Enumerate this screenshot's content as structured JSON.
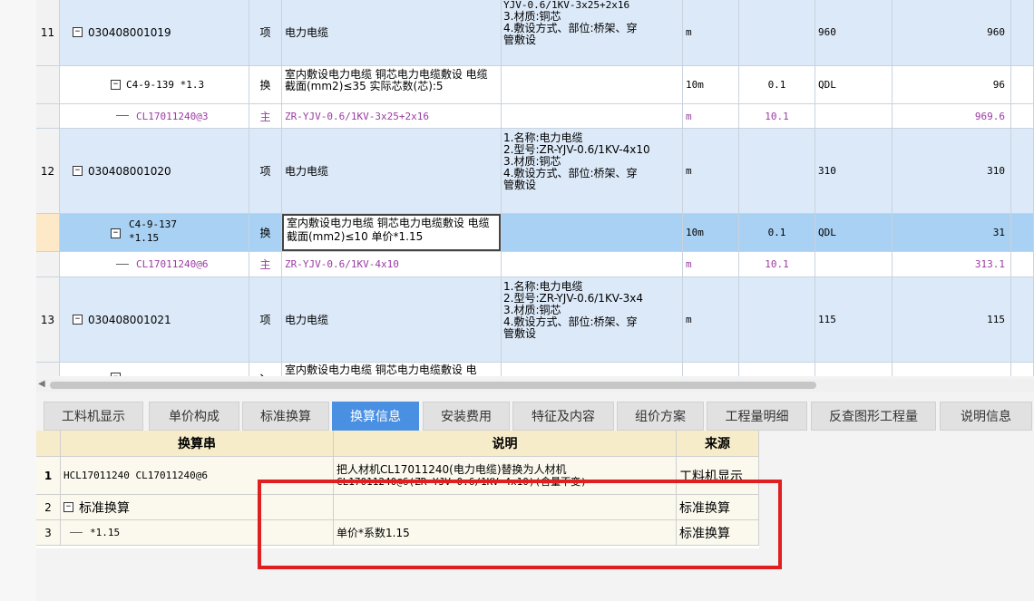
{
  "grid": {
    "row11": {
      "num": "11",
      "code": "030408001019",
      "type": "项",
      "name": "电力电缆",
      "features": [
        "YJV-0.6/1KV-3x25+2x16",
        "3.材质:铜芯",
        "4.敷设方式、部位:桥架、穿",
        "管敷设"
      ],
      "unit": "m",
      "qty": "",
      "expr": "960",
      "amount": "960"
    },
    "row11a": {
      "code": "C4-9-139 *1.3",
      "type": "换",
      "name": "室内敷设电力电缆 铜芯电力电缆敷设 电缆截面(mm2)≤35  实际芯数(芯):5",
      "unit": "10m",
      "qty": "0.1",
      "expr": "QDL",
      "amount": "96"
    },
    "row11b": {
      "code": "CL17011240@3",
      "type": "主",
      "name": "ZR-YJV-0.6/1KV-3x25+2x16",
      "unit": "m",
      "qty": "10.1",
      "amount": "969.6"
    },
    "row12": {
      "num": "12",
      "code": "030408001020",
      "type": "项",
      "name": "电力电缆",
      "features": [
        "1.名称:电力电缆",
        "2.型号:ZR-YJV-0.6/1KV-4x10",
        "3.材质:铜芯",
        "4.敷设方式、部位:桥架、穿",
        "管敷设"
      ],
      "unit": "m",
      "expr": "310",
      "amount": "310"
    },
    "row12a": {
      "code_line1": "C4-9-137",
      "code_line2": "*1.15",
      "type": "换",
      "name": "室内敷设电力电缆 铜芯电力电缆敷设 电缆截面(mm2)≤10  单价*1.15",
      "unit": "10m",
      "qty": "0.1",
      "expr": "QDL",
      "amount": "31"
    },
    "row12b": {
      "code": "CL17011240@6",
      "type": "主",
      "name": "ZR-YJV-0.6/1KV-4x10",
      "unit": "m",
      "qty": "10.1",
      "amount": "313.1"
    },
    "row13": {
      "num": "13",
      "code": "030408001021",
      "type": "项",
      "name": "电力电缆",
      "features": [
        "1.名称:电力电缆",
        "2.型号:ZR-YJV-0.6/1KV-3x4",
        "3.材质:铜芯",
        "4.敷设方式、部位:桥架、穿",
        "管敷设"
      ],
      "unit": "m",
      "expr": "115",
      "amount": "115"
    },
    "row14": {
      "type": "、",
      "name": "室内敷设电力电缆 铜芯电力电缆敷设 电"
    }
  },
  "tabs": [
    "工料机显示",
    "单价构成",
    "标准换算",
    "换算信息",
    "安装费用",
    "特征及内容",
    "组价方案",
    "工程量明细",
    "反查图形工程量",
    "说明信息"
  ],
  "active_tab": "换算信息",
  "lower": {
    "headers": [
      "换算串",
      "说明",
      "来源"
    ],
    "rows": [
      {
        "num": "1",
        "str": "HCL17011240 CL17011240@6",
        "desc_line1": "把人材机CL17011240(电力电缆)替换为人材机",
        "desc_line2": "CL17011240@6(ZR-YJV-0.6/1KV-4x10)(含量不变)",
        "src": "工料机显示"
      },
      {
        "num": "2",
        "str": "标准换算",
        "desc": "",
        "src": "标准换算"
      },
      {
        "num": "3",
        "str": "*1.15",
        "desc": "单价*系数1.15",
        "src": "标准换算"
      }
    ]
  }
}
